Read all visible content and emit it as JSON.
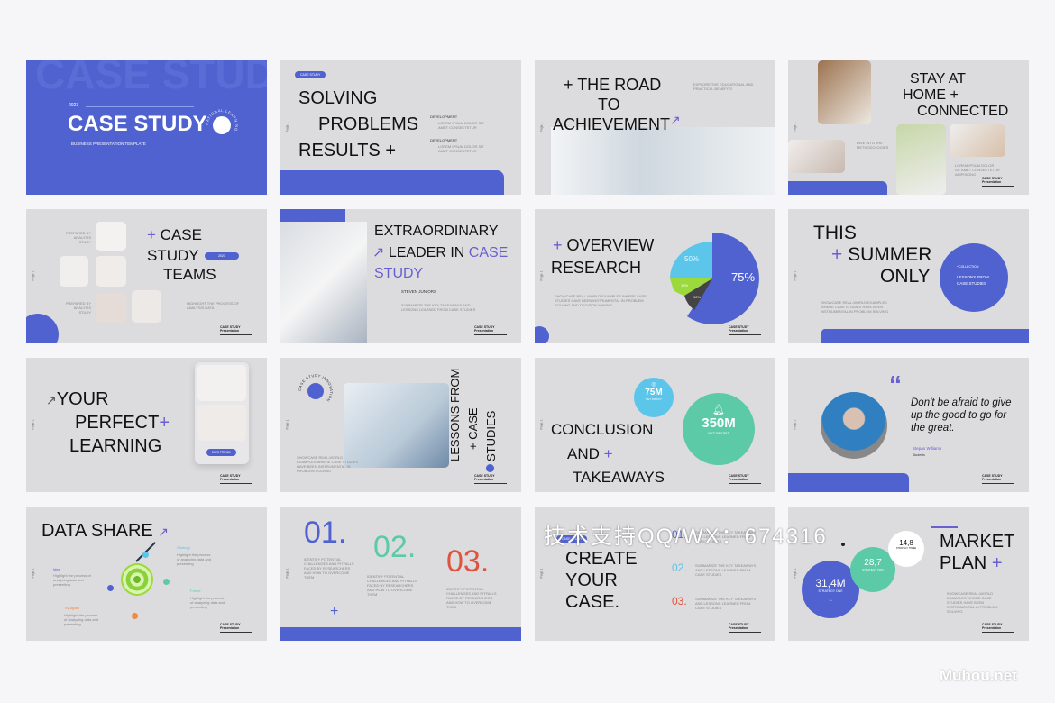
{
  "colors": {
    "primary": "#5062cf",
    "slide_bg": "#dcdcdf",
    "teal": "#5ccaa6",
    "sky": "#5bc5ea",
    "red": "#e0533f",
    "lime": "#9bd93c"
  },
  "s1": {
    "year": "2023",
    "title": "CASE STUDY",
    "subtitle": "BUSINESS PRESENTATION TEMPLATE",
    "bg_word": "CASE STUDY",
    "ring": "NATIONAL LEARNING"
  },
  "s2": {
    "tag": "CASE STUDY",
    "l1": "SOLVING",
    "l2": "PROBLEMS",
    "l3": "RESULTS +",
    "b1": "DEVELOPMENT",
    "b2": "DEVELOPMENT",
    "d": "LOREM IPSUM DOLOR SIT AMET CONSECTETUR"
  },
  "s3": {
    "l1": "+ THE ROAD",
    "l2": "TO",
    "l3": "ACHIEVEMENT",
    "arrow": "↗",
    "d": "EXPLORE THE EDUCATIONAL AND PRACTICAL BENEFITS"
  },
  "s4": {
    "l1": "STAY AT",
    "l2": "HOME +",
    "l3": "CONNECTED",
    "d": "DIVE INTO THE METHODOLOGIES",
    "d2": "LOREM IPSUM DOLOR SIT AMET CONSECTETUR ADIPISCING"
  },
  "s5": {
    "plus": "+",
    "l1": "CASE",
    "l2": "STUDY",
    "l3": "TEAMS",
    "pill": "2023",
    "p1": "PREPARED BY ANALYSIS STUDY",
    "p2": "PREPARED BY ANALYSIS STUDY",
    "d": "HIGHLIGHT THE PROCESS OF ANALYSIS DATA"
  },
  "s6": {
    "l1": "EXTRAORDINARY",
    "arrow": "↗",
    "l2": "LEADER IN",
    "l2b": "CASE",
    "l3": "STUDY",
    "name": "STEVEN JUNIORS",
    "d": "SUMMARIZE THE KEY TAKEAWAYS AND LESSONS LEARNED FROM CASE STUDIES"
  },
  "s7": {
    "plus": "+",
    "l1": "OVERVIEW",
    "l2": "RESEARCH",
    "d": "SHOWCASE REAL-WORLD EXAMPLES WHERE CASE STUDIES HAVE BEEN INSTRUMENTAL IN PROBLEM SOLVING AND DECISION MAKING",
    "pie": [
      {
        "label": "75%",
        "value": 75,
        "color": "#5062cf"
      },
      {
        "label": "50%",
        "value": 50,
        "color": "#5bc5ea"
      },
      {
        "label": "15%",
        "value": 15,
        "color": "#9bd93c"
      },
      {
        "label": "10%",
        "value": 10,
        "color": "#444444"
      }
    ]
  },
  "s8": {
    "l1": "THIS",
    "plus": "+",
    "l2": "SUMMER",
    "l3": "ONLY",
    "c1": "+COLLECTION",
    "c2": "LESSONS FROM CASE STUDIES",
    "d": "SHOWCASE REAL-WORLD EXAMPLES WHERE CASE STUDIES HAVE BEEN INSTRUMENTAL IN PROBLEM SOLVING"
  },
  "s9": {
    "arrow": "↗",
    "l1": "YOUR",
    "l2": "PERFECT",
    "plus": "+",
    "l3": "LEARNING",
    "pill": "2023 TREND"
  },
  "s10": {
    "l1": "LESSONS FROM",
    "l2": "+ CASE",
    "l3": "STUDIES",
    "ring": "CASE STUDY INNOVATION",
    "d": "SHOWCASE REAL-WORLD EXAMPLES WHERE CASE STUDIES HAVE BEEN INSTRUMENTAL IN PROBLEM SOLVING"
  },
  "s11": {
    "l1": "CONCLUSION",
    "l2": "AND",
    "plus": "+",
    "l3": "TAKEAWAYS",
    "v1": "75M",
    "v1l": "NET PROFIT",
    "v2": "350M",
    "v2l": "NET PROFIT"
  },
  "s12": {
    "quote_mark": "“",
    "quote": "Don't be afraid to give up the good to go for the great.",
    "name": "Stepan Williams",
    "role": "Students"
  },
  "s13": {
    "title": "DATA SHARE",
    "arrow": "↗",
    "i1": "Idea",
    "i2": "Strategy",
    "i3": "Try Again",
    "i4": "Future",
    "d": "Highlight the process of analyzing data and presenting"
  },
  "s14": {
    "n1": "01.",
    "n2": "02.",
    "n3": "03.",
    "d": "IDENTIFY POTENTIAL CHALLENGES AND PITFALLS FACED BY RESEARCHERS AND HOW TO OVERCOME THEM",
    "plus": "+"
  },
  "s15": {
    "tag": "CASE STUDY",
    "l1": "CREATE",
    "l2": "YOUR",
    "l3": "CASE.",
    "n1": "01.",
    "n2": "02.",
    "n3": "03.",
    "d": "SUMMARIZE THE KEY TAKEAWAYS AND LESSONS LEARNED FROM CASE STUDIES"
  },
  "s16": {
    "l1": "MARKET",
    "l2": "PLAN",
    "plus": "+",
    "b1": "31,4M",
    "b1l": "STRATEGY ONE",
    "b2": "28,7",
    "b2l": "STRATEGY TWO",
    "b3": "14,8",
    "b3l": "STRATEGY THREE",
    "arrow": "→",
    "d": "SHOWCASE REAL-WORLD EXAMPLES WHERE CASE STUDIES HAVE BEEN INSTRUMENTAL IN PROBLEM SOLVING"
  },
  "footer": "CASE STUDY Presentation",
  "page": "Page 1",
  "watermark": "技术支持QQ/WX：674316",
  "watermark2": "Muhou.net"
}
